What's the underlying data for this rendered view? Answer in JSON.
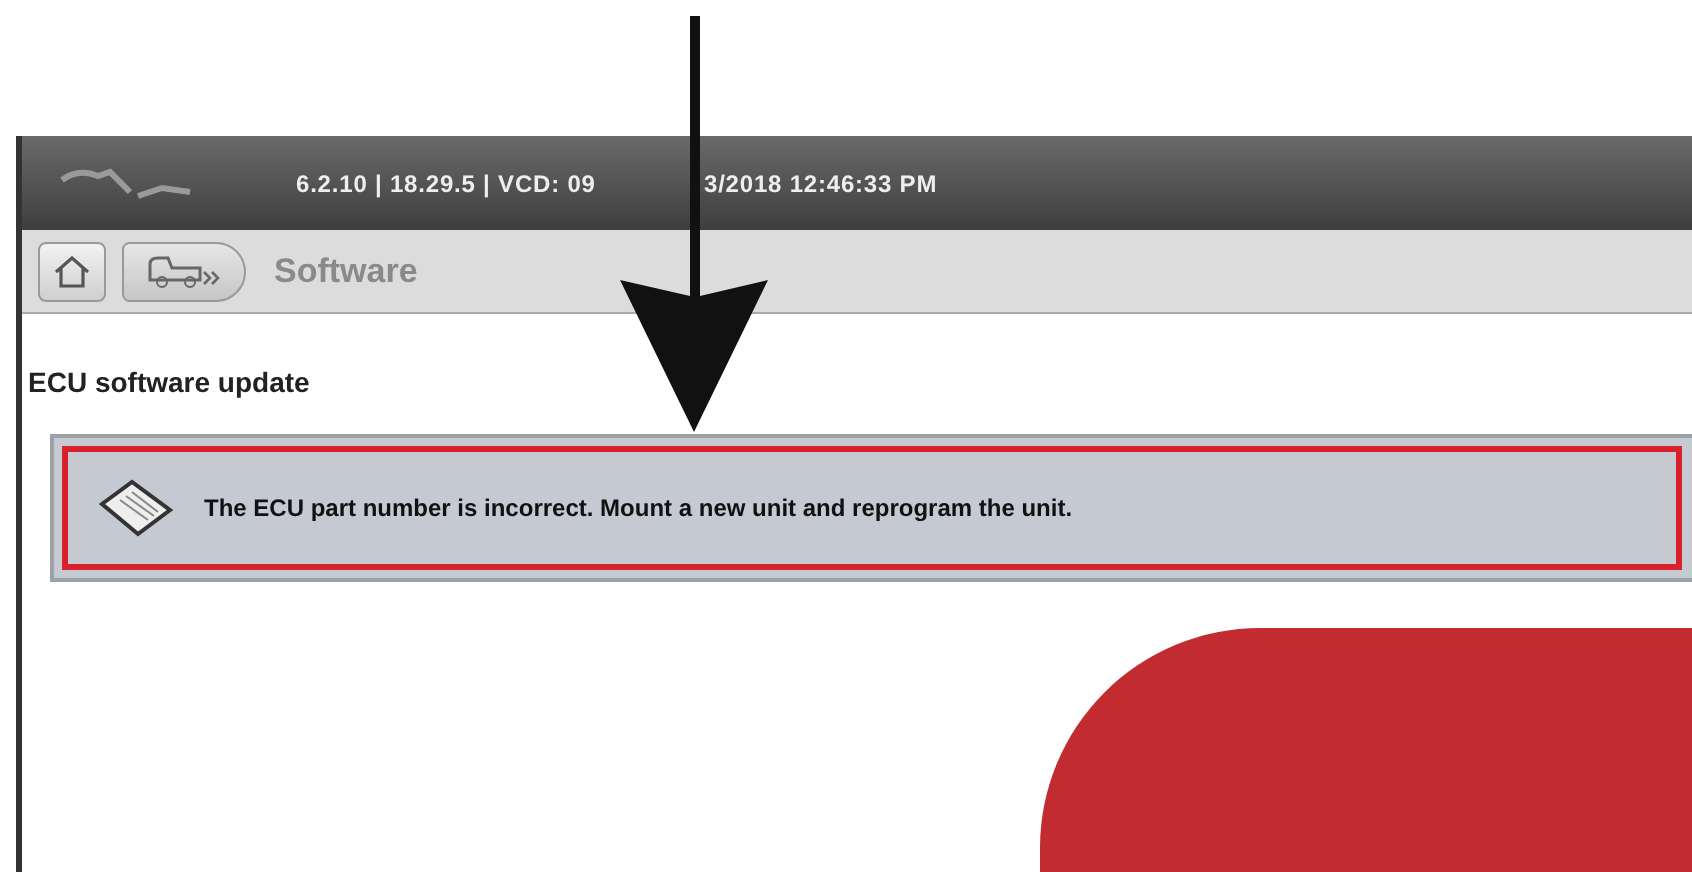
{
  "title_bar": {
    "version_parts": [
      "6.2.10 | 18.29.5 | VCD: 09",
      "3/2018 12:46:33 PM"
    ]
  },
  "toolbar": {
    "breadcrumb": "Software"
  },
  "page": {
    "heading": "ECU software update",
    "message": {
      "text": "The ECU part number is incorrect. Mount a new unit and reprogram the unit.",
      "highlighted": true
    }
  }
}
